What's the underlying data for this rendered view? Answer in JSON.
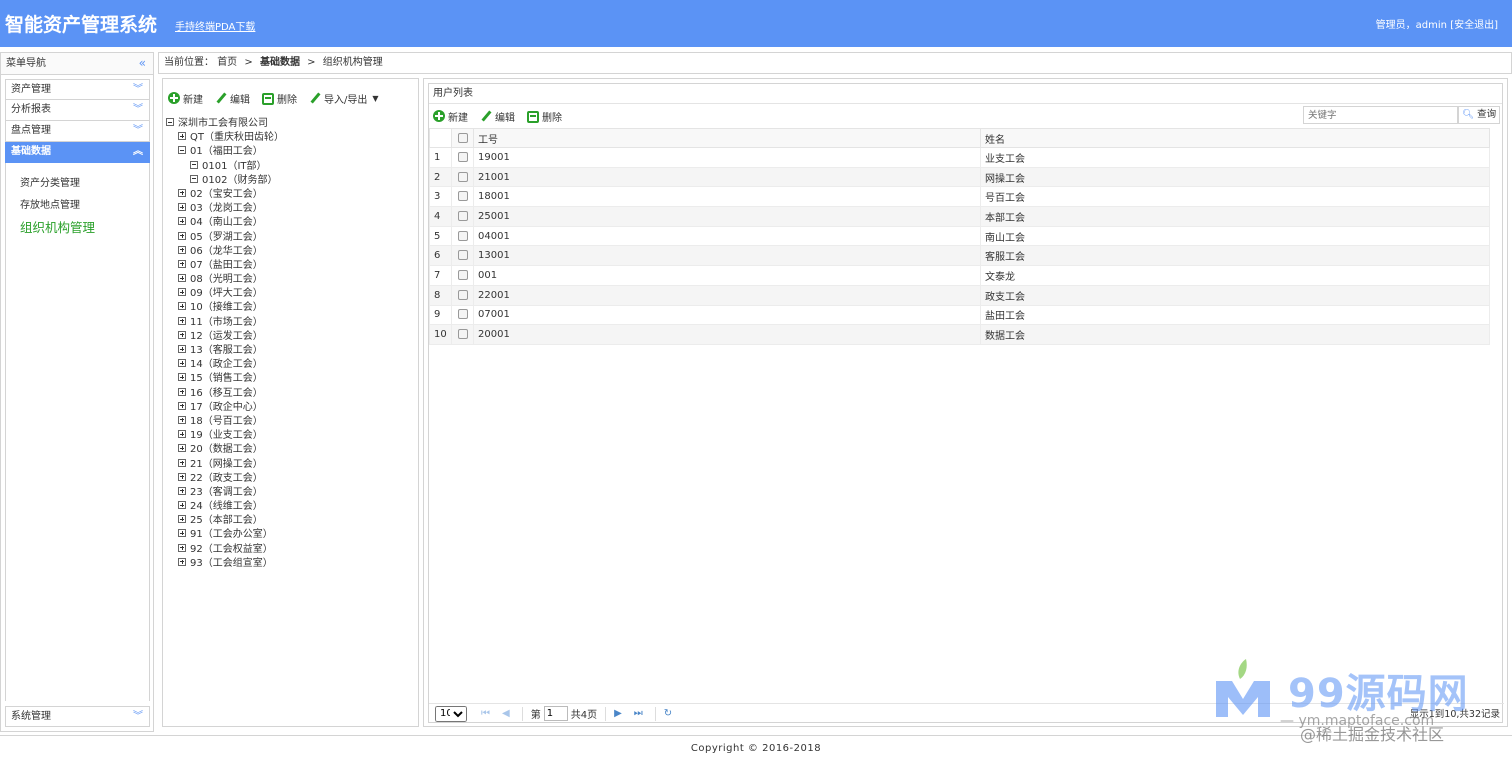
{
  "header": {
    "app_title": "智能资产管理系统",
    "pda_link": "手持终端PDA下载",
    "user_label": "管理员，admin",
    "logout": "[安全退出]"
  },
  "sidebar": {
    "title": "菜单导航",
    "collapse_icon": "double-chevron-left-icon",
    "menus": [
      {
        "label": "资产管理",
        "active": false
      },
      {
        "label": "分析报表",
        "active": false
      },
      {
        "label": "盘点管理",
        "active": false
      },
      {
        "label": "基础数据",
        "active": true
      }
    ],
    "submenu": [
      {
        "label": "资产分类管理"
      },
      {
        "label": "存放地点管理"
      },
      {
        "label": "组织机构管理",
        "current": true
      }
    ],
    "bottom_menu": {
      "label": "系统管理"
    },
    "accent_color": "#5b93f5",
    "current_color": "#2aa02a"
  },
  "breadcrumb": {
    "prefix": "当前位置：",
    "home": "首页",
    "sep": ">",
    "section": "基础数据",
    "page": "组织机构管理"
  },
  "tree_toolbar": {
    "add": "新建",
    "edit": "编辑",
    "delete": "删除",
    "import_export": "导入/导出"
  },
  "tree": {
    "root": "深圳市工会有限公司",
    "nodes": [
      {
        "label": "QT（重庆秋田齿轮）",
        "level": 1,
        "expanded": false
      },
      {
        "label": "01（福田工会）",
        "level": 1,
        "expanded": true
      },
      {
        "label": "0101（IT部）",
        "level": 2,
        "expanded": true
      },
      {
        "label": "0102（财务部）",
        "level": 2,
        "expanded": true
      },
      {
        "label": "02（宝安工会）",
        "level": 1,
        "expanded": false
      },
      {
        "label": "03（龙岗工会）",
        "level": 1,
        "expanded": false
      },
      {
        "label": "04（南山工会）",
        "level": 1,
        "expanded": false
      },
      {
        "label": "05（罗湖工会）",
        "level": 1,
        "expanded": false
      },
      {
        "label": "06（龙华工会）",
        "level": 1,
        "expanded": false
      },
      {
        "label": "07（盐田工会）",
        "level": 1,
        "expanded": false
      },
      {
        "label": "08（光明工会）",
        "level": 1,
        "expanded": false
      },
      {
        "label": "09（坪大工会）",
        "level": 1,
        "expanded": false
      },
      {
        "label": "10（接维工会）",
        "level": 1,
        "expanded": false
      },
      {
        "label": "11（市场工会）",
        "level": 1,
        "expanded": false
      },
      {
        "label": "12（运发工会）",
        "level": 1,
        "expanded": false
      },
      {
        "label": "13（客服工会）",
        "level": 1,
        "expanded": false
      },
      {
        "label": "14（政企工会）",
        "level": 1,
        "expanded": false
      },
      {
        "label": "15（销售工会）",
        "level": 1,
        "expanded": false
      },
      {
        "label": "16（移互工会）",
        "level": 1,
        "expanded": false
      },
      {
        "label": "17（政企中心）",
        "level": 1,
        "expanded": false
      },
      {
        "label": "18（号百工会）",
        "level": 1,
        "expanded": false
      },
      {
        "label": "19（业支工会）",
        "level": 1,
        "expanded": false
      },
      {
        "label": "20（数据工会）",
        "level": 1,
        "expanded": false
      },
      {
        "label": "21（网操工会）",
        "level": 1,
        "expanded": false
      },
      {
        "label": "22（政支工会）",
        "level": 1,
        "expanded": false
      },
      {
        "label": "23（客调工会）",
        "level": 1,
        "expanded": false
      },
      {
        "label": "24（线维工会）",
        "level": 1,
        "expanded": false
      },
      {
        "label": "25（本部工会）",
        "level": 1,
        "expanded": false
      },
      {
        "label": "91（工会办公室）",
        "level": 1,
        "expanded": false
      },
      {
        "label": "92（工会权益室）",
        "level": 1,
        "expanded": false
      },
      {
        "label": "93（工会组宣室）",
        "level": 1,
        "expanded": false
      }
    ]
  },
  "grid": {
    "title": "用户列表",
    "toolbar": {
      "add": "新建",
      "edit": "编辑",
      "delete": "删除"
    },
    "search": {
      "placeholder": "关键字",
      "button": "查询"
    },
    "columns": [
      "工号",
      "姓名"
    ],
    "rows": [
      {
        "num": "1",
        "id": "19001",
        "name": "业支工会"
      },
      {
        "num": "2",
        "id": "21001",
        "name": "网操工会"
      },
      {
        "num": "3",
        "id": "18001",
        "name": "号百工会"
      },
      {
        "num": "4",
        "id": "25001",
        "name": "本部工会"
      },
      {
        "num": "5",
        "id": "04001",
        "name": "南山工会"
      },
      {
        "num": "6",
        "id": "13001",
        "name": "客服工会"
      },
      {
        "num": "7",
        "id": "001",
        "name": "文泰龙"
      },
      {
        "num": "8",
        "id": "22001",
        "name": "政支工会"
      },
      {
        "num": "9",
        "id": "07001",
        "name": "盐田工会"
      },
      {
        "num": "10",
        "id": "20001",
        "name": "数据工会"
      }
    ],
    "pager": {
      "page_size": "10",
      "page_label": "第",
      "page_value": "1",
      "total_pages": "共4页",
      "info": "显示1到10,共32记录"
    }
  },
  "footer": {
    "copyright": "Copyright © 2016-2018"
  },
  "watermark": {
    "main": "99源码网",
    "sub": "— ym.maptoface.com",
    "community": "@稀土掘金技术社区"
  }
}
